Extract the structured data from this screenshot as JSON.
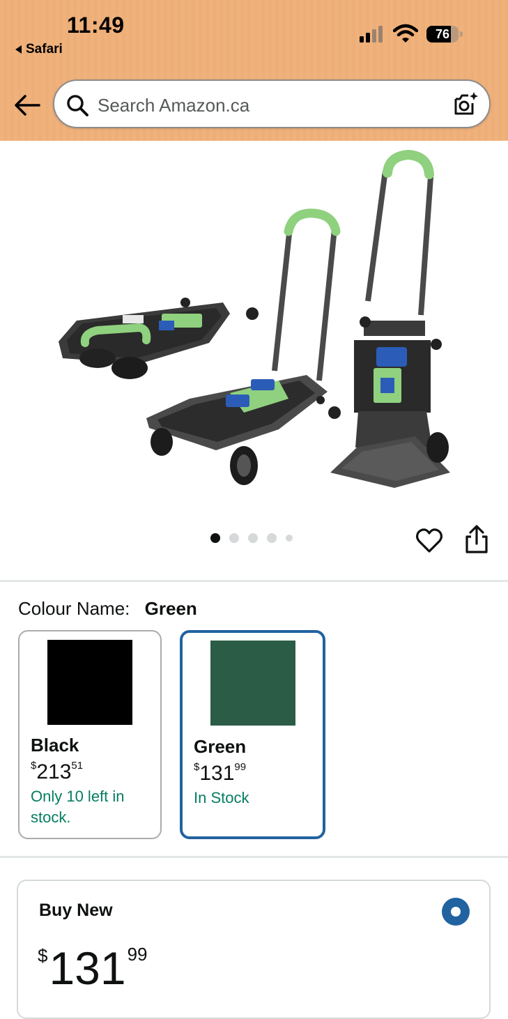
{
  "status_bar": {
    "time": "11:49",
    "back_app": "Safari",
    "battery": "76"
  },
  "search": {
    "placeholder": "Search Amazon.ca"
  },
  "gallery": {
    "image_count": 5,
    "active_index": 0
  },
  "colour": {
    "label": "Colour Name:",
    "selected": "Green",
    "options": [
      {
        "name": "Black",
        "price_dollars": "213",
        "price_cents": "51",
        "currency": "$",
        "stock": "Only 10 left in stock.",
        "swatch_color": "#000000"
      },
      {
        "name": "Green",
        "price_dollars": "131",
        "price_cents": "99",
        "currency": "$",
        "stock": "In Stock",
        "swatch_color": "#2a5c46"
      }
    ]
  },
  "buy_box": {
    "title": "Buy New",
    "currency": "$",
    "price_dollars": "131",
    "price_cents": "99"
  },
  "colors": {
    "header_bg": "#f0b27c",
    "accent_blue": "#2162a1",
    "stock_green": "#067d62"
  }
}
